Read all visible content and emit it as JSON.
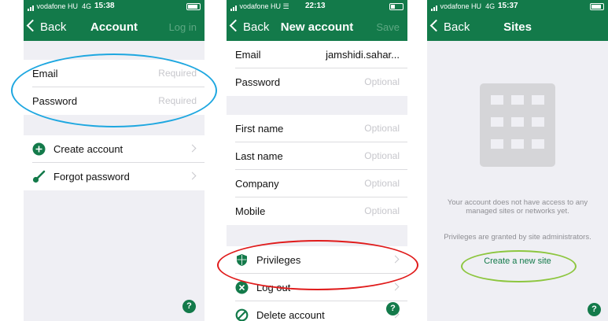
{
  "screens": [
    {
      "status": {
        "carrier": "vodafone HU",
        "network": "4G",
        "time": "15:38"
      },
      "nav": {
        "back": "Back",
        "title": "Account",
        "action": "Log in"
      },
      "fields": [
        {
          "label": "Email",
          "value": "Required"
        },
        {
          "label": "Password",
          "value": "Required"
        }
      ],
      "actions": [
        {
          "label": "Create account",
          "icon": "plus-circle-icon"
        },
        {
          "label": "Forgot password",
          "icon": "key-icon"
        }
      ],
      "help": "?"
    },
    {
      "status": {
        "carrier": "vodafone HU",
        "time": "22:13"
      },
      "nav": {
        "back": "Back",
        "title": "New account",
        "action": "Save"
      },
      "fields": [
        {
          "label": "Email",
          "value": "jamshidi.sahar..."
        },
        {
          "label": "Password",
          "value": "Optional"
        },
        {
          "label": "First name",
          "value": "Optional"
        },
        {
          "label": "Last name",
          "value": "Optional"
        },
        {
          "label": "Company",
          "value": "Optional"
        },
        {
          "label": "Mobile",
          "value": "Optional"
        }
      ],
      "actions": [
        {
          "label": "Privileges",
          "icon": "shield-icon"
        },
        {
          "label": "Log out",
          "icon": "close-circle-icon"
        },
        {
          "label": "Delete account",
          "icon": "no-entry-icon"
        }
      ],
      "help": "?"
    },
    {
      "status": {
        "carrier": "vodafone HU",
        "network": "4G",
        "time": "15:37"
      },
      "nav": {
        "back": "Back",
        "title": "Sites"
      },
      "message1": "Your account does not have access to any managed sites or networks yet.",
      "message2": "Privileges are granted by site administrators.",
      "link": "Create a new site",
      "help": "?"
    }
  ],
  "colors": {
    "brand": "#137a4a",
    "highlight_blue": "#1ea7e0",
    "highlight_red": "#e01b1b",
    "highlight_green": "#8dc63f"
  }
}
